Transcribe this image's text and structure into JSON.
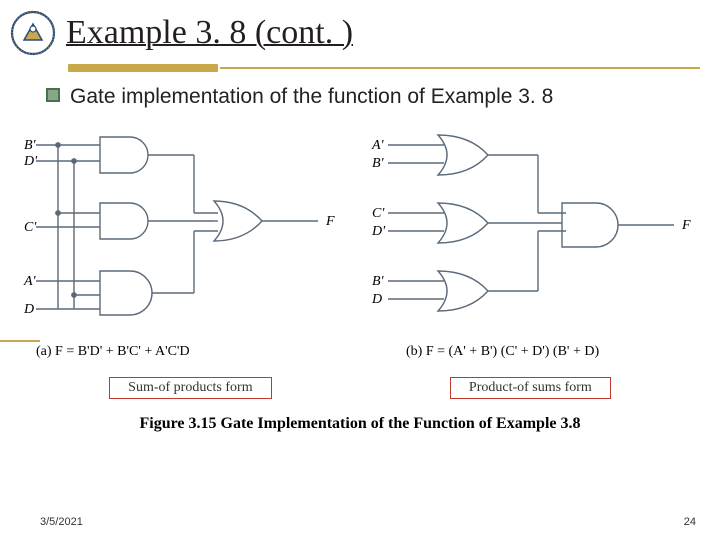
{
  "header": {
    "title": "Example 3. 8 (cont. )"
  },
  "bullet": {
    "text": "Gate implementation of the function of Example 3. 8"
  },
  "left": {
    "inputs": [
      "B'",
      "D'",
      "C'",
      "A'",
      "D"
    ],
    "output": "F",
    "equation": "(a) F = B'D' + B'C' + A'C'D",
    "tag": "Sum-of products form"
  },
  "right": {
    "inputs": [
      "A'",
      "B'",
      "C'",
      "D'",
      "B'",
      "D"
    ],
    "output": "F",
    "equation": "(b) F = (A' + B') (C' + D') (B' + D)",
    "tag": "Product-of sums form"
  },
  "figure_caption": "Figure 3.15 Gate Implementation of the Function of Example 3.8",
  "footer": {
    "date": "3/5/2021",
    "page": "24"
  }
}
